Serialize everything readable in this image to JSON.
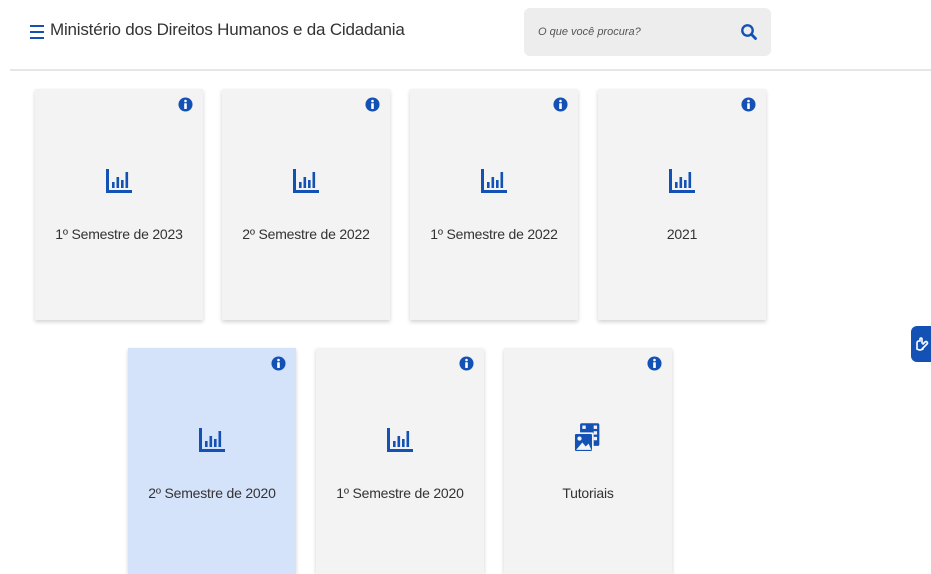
{
  "header": {
    "menu_icon": "hamburger-menu-icon",
    "title": "Ministério dos Direitos Humanos e da Cidadania",
    "search": {
      "placeholder": "O que você procura?",
      "value": "",
      "icon": "search-icon"
    }
  },
  "cards": [
    {
      "label": "1º Semestre de 2023",
      "icon": "bar-chart-icon",
      "selected": false
    },
    {
      "label": "2º Semestre de 2022",
      "icon": "bar-chart-icon",
      "selected": false
    },
    {
      "label": "1º Semestre de 2022",
      "icon": "bar-chart-icon",
      "selected": false
    },
    {
      "label": "2021",
      "icon": "bar-chart-icon",
      "selected": false
    },
    {
      "label": "2º Semestre de 2020",
      "icon": "bar-chart-icon",
      "selected": true
    },
    {
      "label": "1º Semestre de 2020",
      "icon": "bar-chart-icon",
      "selected": false
    },
    {
      "label": "Tutoriais",
      "icon": "video-gallery-icon",
      "selected": false
    }
  ],
  "vlibras_icon": "sign-language-hands-icon",
  "colors": {
    "accent": "#1351b4",
    "card_bg": "#f3f3f3",
    "card_selected_bg": "#d4e3fa",
    "text": "#333333"
  }
}
